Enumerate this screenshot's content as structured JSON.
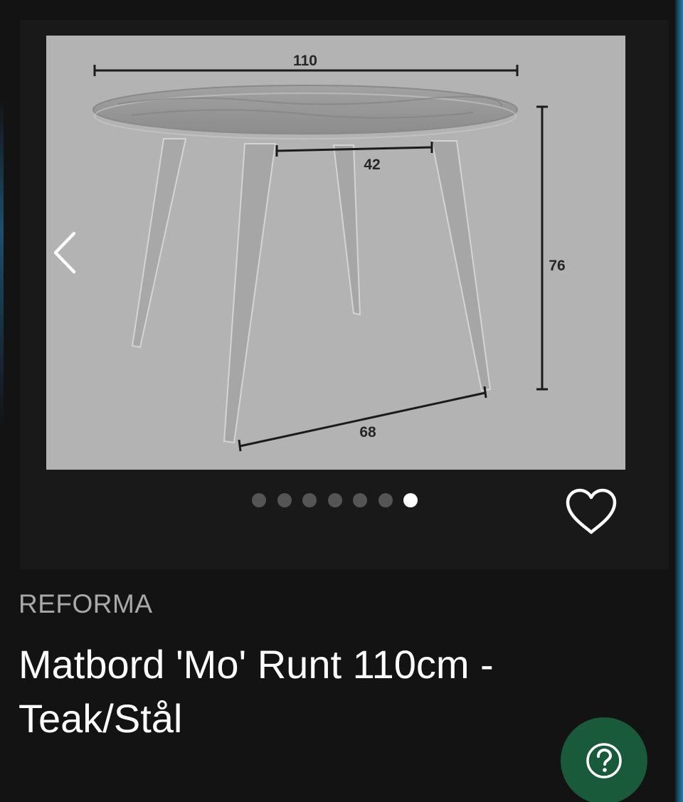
{
  "product": {
    "brand": "REFORMA",
    "title": "Matbord 'Mo' Runt 110cm - Teak/Stål"
  },
  "gallery": {
    "dimensions": {
      "width": "110",
      "leg_spread_top": "42",
      "height": "76",
      "leg_spread_bottom": "68"
    },
    "image_count": 7,
    "active_index": 7
  },
  "icons": {
    "prev": "chevron-left-icon",
    "favorite": "heart-outline-icon",
    "help": "question-mark-icon"
  },
  "colors": {
    "background": "#131313",
    "card": "#191919",
    "image_bg": "#b3b3b3",
    "dot_inactive": "#555555",
    "dot_active": "#ffffff",
    "help_button": "#195a3a",
    "brand_text": "#a9a9a9",
    "title_text": "#ffffff"
  }
}
